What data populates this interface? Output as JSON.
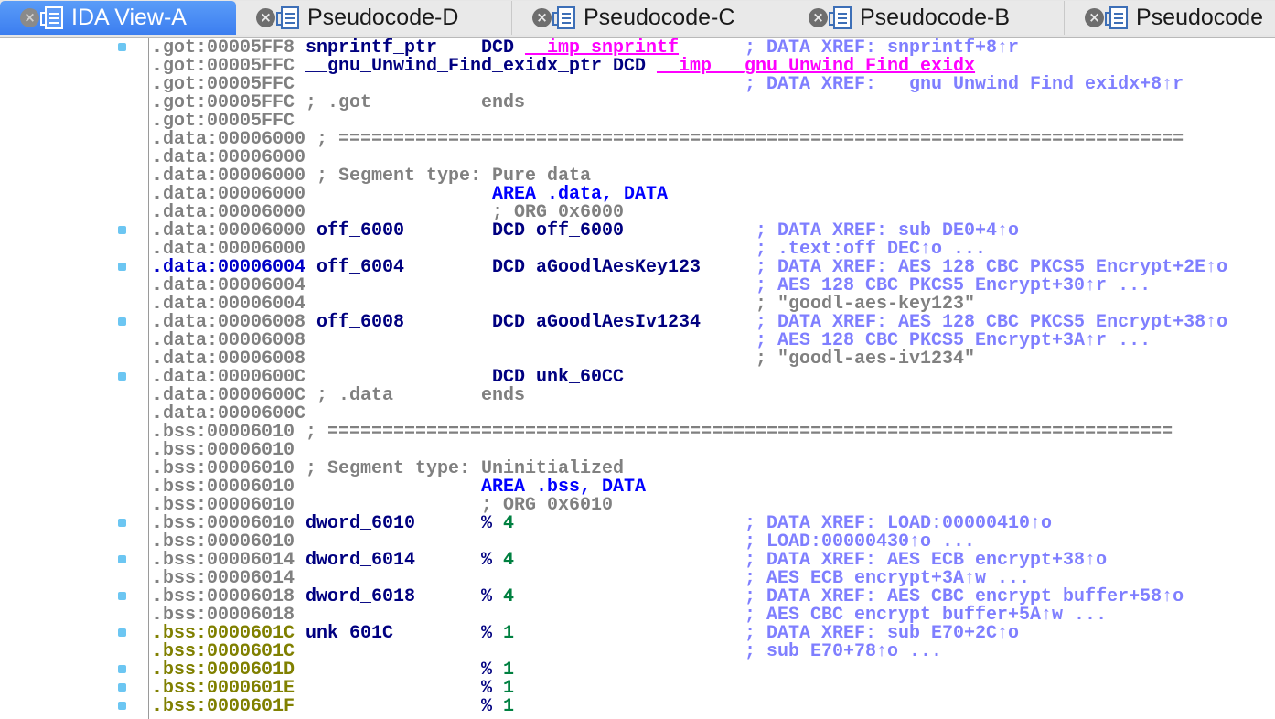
{
  "tabs": [
    {
      "label": "IDA View-A",
      "active": true
    },
    {
      "label": "Pseudocode-D",
      "active": false
    },
    {
      "label": "Pseudocode-C",
      "active": false
    },
    {
      "label": "Pseudocode-B",
      "active": false
    },
    {
      "label": "Pseudocode",
      "active": false
    }
  ],
  "colors": {
    "address": "#808080",
    "address_current": "#0000c8",
    "address_bss_sel": "#808000",
    "name": "#000080",
    "keyword": "#0000ff",
    "import": "#ff00ff",
    "xref": "#7f7fff",
    "number": "#008040",
    "breakpoint": "#6cc6f2"
  },
  "lines": [
    {
      "addr": ".got:00005FF8",
      "name": "snprintf_ptr",
      "op": "DCD",
      "imp": "__imp_snprintf",
      "xref": "; DATA XREF: snprintf+8↑r"
    },
    {
      "addr": ".got:00005FFC",
      "name": "__gnu_Unwind_Find_exidx_ptr",
      "op": "DCD",
      "imp": "__imp___gnu_Unwind_Find_exidx"
    },
    {
      "addr": ".got:00005FFC",
      "xref": "; DATA XREF:   gnu Unwind Find exidx+8↑r"
    },
    {
      "addr": ".got:00005FFC",
      "cmt": "; .got",
      "op2": "ends"
    },
    {
      "addr": ".got:00005FFC"
    },
    {
      "addr": ".data:00006000",
      "sep": "; ============================================================================="
    },
    {
      "addr": ".data:00006000"
    },
    {
      "addr": ".data:00006000",
      "cmt": "; Segment type: Pure data"
    },
    {
      "addr": ".data:00006000",
      "kw": "AREA .data, DATA"
    },
    {
      "addr": ".data:00006000",
      "org": "; ORG 0x6000"
    },
    {
      "addr": ".data:00006000",
      "name": "off_6000",
      "op": "DCD",
      "arg": "off_6000",
      "xref": "; DATA XREF: sub DE0+4↑o"
    },
    {
      "addr": ".data:00006000",
      "xref": "; .text:off DEC↑o ..."
    },
    {
      "addr": ".data:00006004",
      "name": "off_6004",
      "op": "DCD",
      "arg": "aGoodlAesKey123",
      "xref": "; DATA XREF: AES 128 CBC PKCS5 Encrypt+2E↑o"
    },
    {
      "addr": ".data:00006004",
      "xref": "; AES 128 CBC PKCS5 Encrypt+30↑r ..."
    },
    {
      "addr": ".data:00006004",
      "str": "; \"goodl-aes-key123\""
    },
    {
      "addr": ".data:00006008",
      "name": "off_6008",
      "op": "DCD",
      "arg": "aGoodlAesIv1234",
      "xref": "; DATA XREF: AES 128 CBC PKCS5 Encrypt+38↑o"
    },
    {
      "addr": ".data:00006008",
      "xref": "; AES 128 CBC PKCS5 Encrypt+3A↑r ..."
    },
    {
      "addr": ".data:00006008",
      "str": "; \"goodl-aes-iv1234\""
    },
    {
      "addr": ".data:0000600C",
      "op": "DCD",
      "arg": "unk_60CC"
    },
    {
      "addr": ".data:0000600C",
      "cmt": "; .data",
      "op2": "ends"
    },
    {
      "addr": ".data:0000600C"
    },
    {
      "addr": ".bss:00006010",
      "sep": "; ============================================================================="
    },
    {
      "addr": ".bss:00006010"
    },
    {
      "addr": ".bss:00006010",
      "cmt": "; Segment type: Uninitialized"
    },
    {
      "addr": ".bss:00006010",
      "kw": "AREA .bss, DATA"
    },
    {
      "addr": ".bss:00006010",
      "org": "; ORG 0x6010"
    },
    {
      "addr": ".bss:00006010",
      "name": "dword_6010",
      "op": "%",
      "num": "4",
      "xref": "; DATA XREF: LOAD:00000410↑o"
    },
    {
      "addr": ".bss:00006010",
      "xref": "; LOAD:00000430↑o ..."
    },
    {
      "addr": ".bss:00006014",
      "name": "dword_6014",
      "op": "%",
      "num": "4",
      "xref": "; DATA XREF: AES ECB encrypt+38↑o"
    },
    {
      "addr": ".bss:00006014",
      "xref": "; AES ECB encrypt+3A↑w ..."
    },
    {
      "addr": ".bss:00006018",
      "name": "dword_6018",
      "op": "%",
      "num": "4",
      "xref": "; DATA XREF: AES CBC encrypt buffer+58↑o"
    },
    {
      "addr": ".bss:00006018",
      "xref": "; AES CBC encrypt buffer+5A↑w ..."
    },
    {
      "addr": ".bss:0000601C",
      "name": "unk_601C",
      "op": "%",
      "num": "1",
      "xref": "; DATA XREF: sub E70+2C↑o"
    },
    {
      "addr": ".bss:0000601C",
      "xref": "; sub E70+78↑o ..."
    },
    {
      "addr": ".bss:0000601D",
      "op": "%",
      "num": "1"
    },
    {
      "addr": ".bss:0000601E",
      "op": "%",
      "num": "1"
    },
    {
      "addr": ".bss:0000601F",
      "op": "%",
      "num": "1"
    }
  ]
}
